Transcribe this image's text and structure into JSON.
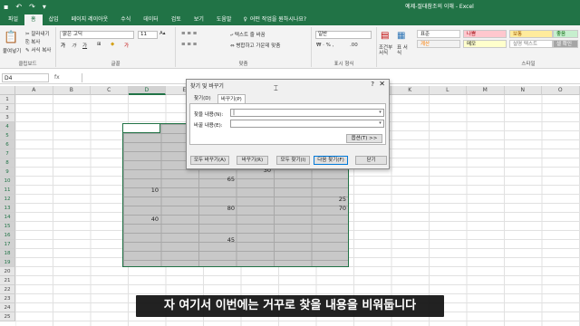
{
  "window": {
    "title": "예제-절대참조의 이해  -  Excel"
  },
  "tabs": [
    "파일",
    "홈",
    "삽입",
    "페이지 레이아웃",
    "수식",
    "데이터",
    "검토",
    "보기",
    "도움말"
  ],
  "tell_me": "어떤 작업을 원하시나요?",
  "ribbon": {
    "clipboard": {
      "label": "클립보드",
      "paste": "붙여넣기",
      "cut": "잘라내기",
      "copy": "복사",
      "format_painter": "서식 복사"
    },
    "font": {
      "label": "글꼴",
      "name": "맑은 고딕",
      "size": "11"
    },
    "alignment": {
      "label": "맞춤",
      "wrap": "텍스트 줄 바꿈",
      "merge": "병합하고 가운데 맞춤"
    },
    "number": {
      "label": "표시 형식",
      "format": "일반"
    },
    "styles": {
      "label": "스타일",
      "cond": "조건부 서식",
      "table": "표 서식",
      "chips": [
        {
          "text": "표준",
          "bg": "#ffffff",
          "fg": "#222222"
        },
        {
          "text": "나쁨",
          "bg": "#ffc7ce",
          "fg": "#9c0006"
        },
        {
          "text": "보통",
          "bg": "#ffeb9c",
          "fg": "#9c5700"
        },
        {
          "text": "좋음",
          "bg": "#c6efce",
          "fg": "#006100"
        },
        {
          "text": "계산",
          "bg": "#f2f2f2",
          "fg": "#fa7d00"
        },
        {
          "text": "메모",
          "bg": "#ffffcc",
          "fg": "#222222"
        },
        {
          "text": "설명 텍스트",
          "bg": "#ffffff",
          "fg": "#7f7f7f"
        },
        {
          "text": "셀 확인",
          "bg": "#a5a5a5",
          "fg": "#ffffff"
        }
      ]
    }
  },
  "formula_bar": {
    "name_box": "D4",
    "fx": "fx"
  },
  "columns": [
    "A",
    "B",
    "C",
    "D",
    "E",
    "F",
    "G",
    "H",
    "I",
    "J",
    "K",
    "L",
    "M",
    "N",
    "O"
  ],
  "rows": [
    "1",
    "2",
    "3",
    "4",
    "5",
    "6",
    "7",
    "8",
    "9",
    "10",
    "11",
    "12",
    "13",
    "14",
    "15",
    "16",
    "17",
    "18",
    "19",
    "20",
    "21",
    "22",
    "23",
    "24",
    "25"
  ],
  "cells": [
    {
      "value": "30"
    },
    {
      "value": "65"
    },
    {
      "value": "10"
    },
    {
      "value": "25"
    },
    {
      "value": "80"
    },
    {
      "value": "70"
    },
    {
      "value": "40"
    },
    {
      "value": "45"
    }
  ],
  "dialog": {
    "title": "찾기 및 바꾸기",
    "help": "?",
    "close": "✕",
    "tab_find": "찾기(D)",
    "tab_replace": "바꾸기(P)",
    "find_label": "찾을 내용(N):",
    "find_value": "|",
    "replace_label": "바꿀 내용(E):",
    "replace_value": "",
    "options_button": "옵션(T) >>",
    "replace_all": "모두 바꾸기(A)",
    "replace": "바꾸기(R)",
    "find_all": "모두 찾기(I)",
    "find_next": "다음 찾기(F)",
    "close_button": "닫기"
  },
  "subtitle": "자 여기서 이번에는 거꾸로 찾을 내용을 비워둡니다",
  "colors": {
    "excel_green": "#217346",
    "selection_fill": "#c8c8c8"
  }
}
